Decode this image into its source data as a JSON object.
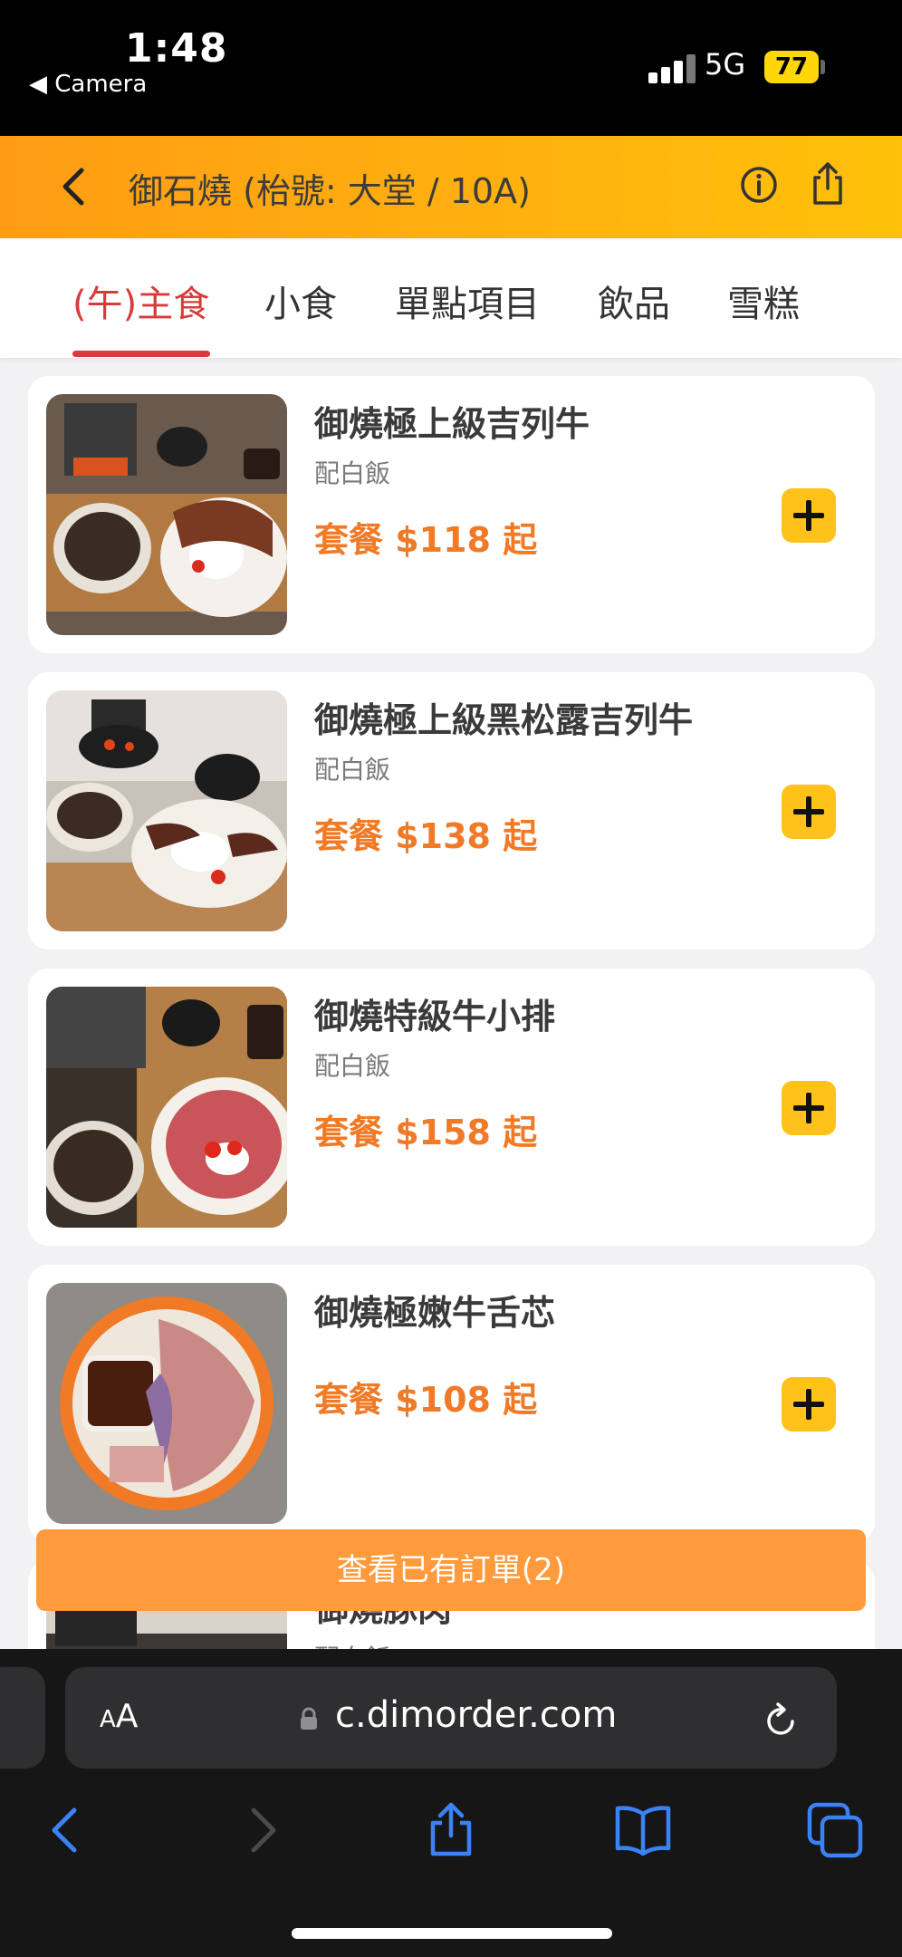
{
  "status_bar": {
    "time": "1:48",
    "back_app": "◀ Camera",
    "network": "5G",
    "battery": "77"
  },
  "header": {
    "title": "御石燒 (枱號: 大堂 / 10A)",
    "back_icon": "chevron-left-icon",
    "info_icon": "info-circle-icon",
    "share_icon": "share-icon"
  },
  "tabs": [
    {
      "label": "(午)主食",
      "active": true
    },
    {
      "label": "小食"
    },
    {
      "label": "單點項目"
    },
    {
      "label": "飲品"
    },
    {
      "label": "雪糕"
    }
  ],
  "menu": [
    {
      "name": "御燒極上級吉列牛",
      "sub": "配白飯",
      "price": "套餐 $118 起"
    },
    {
      "name": "御燒極上級黑松露吉列牛",
      "sub": "配白飯",
      "price": "套餐 $138 起"
    },
    {
      "name": "御燒特級牛小排",
      "sub": "配白飯",
      "price": "套餐 $158 起"
    },
    {
      "name": "御燒極嫩牛舌芯",
      "sub": "",
      "price": "套餐 $108 起"
    },
    {
      "name": "御燒豚肉",
      "sub": "配白飯",
      "price": ""
    }
  ],
  "order_button": "查看已有訂單(2)",
  "browser": {
    "aa_label": "AA",
    "url": "c.dimorder.com",
    "toolbar_icons": [
      "back-arrow-icon",
      "forward-arrow-icon",
      "share-icon",
      "bookmarks-icon",
      "tabs-icon"
    ]
  },
  "colors": {
    "header_start": "#ff9c14",
    "header_end": "#ffc10a",
    "active_tab": "#d93a3a",
    "price": "#f07a26",
    "add_button": "#ffc21a",
    "order_bar": "#ff9a3d"
  }
}
